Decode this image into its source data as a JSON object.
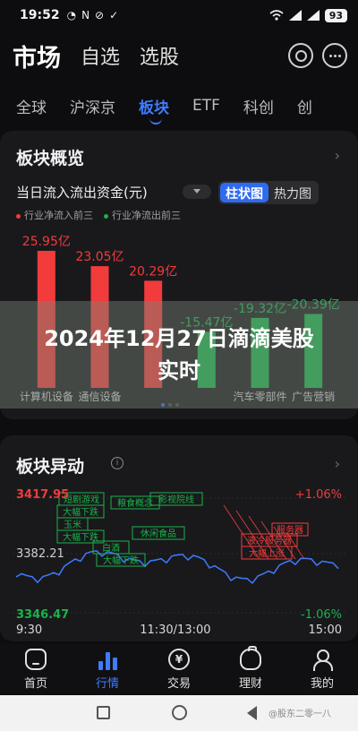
{
  "status_bar": {
    "time": "19:52",
    "icons": [
      "◔",
      "N",
      "⊘",
      "✓"
    ],
    "battery": "93"
  },
  "header": {
    "title": "市场",
    "tabs": [
      "自选",
      "选股"
    ]
  },
  "market_tabs": [
    "全球",
    "沪深京",
    "板块",
    "ETF",
    "科创",
    "创"
  ],
  "active_market_tab": 2,
  "overview": {
    "title": "板块概览",
    "subtitle": "当日流入流出资金(元)",
    "view_toggle": [
      "柱状图",
      "热力图"
    ],
    "legend": [
      "行业净流入前三",
      "行业净流出前三"
    ],
    "chevron": "›"
  },
  "chart_data": {
    "type": "bar",
    "categories": [
      "计算机设备",
      "通信设备",
      "",
      "",
      "汽车零部件",
      "广告营销"
    ],
    "values": [
      25.95,
      23.05,
      20.29,
      -15.47,
      -19.32,
      -20.39
    ],
    "labels": [
      "25.95亿",
      "23.05亿",
      "20.29亿",
      "-15.47亿",
      "-19.32亿",
      "-20.39亿"
    ],
    "ylabel": "亿",
    "colors": {
      "positive": "#f23b3b",
      "negative": "#19b34a"
    }
  },
  "banner": {
    "text": "2024年12月27日滴滴美股实时"
  },
  "movement": {
    "title": "板块异动",
    "info_icon": "i",
    "chevron": "›",
    "y_labels": [
      "3417.95",
      "3382.21",
      "3346.47"
    ],
    "pct_labels": [
      "+1.06%",
      "-1.06%"
    ],
    "time_labels": [
      "9:30",
      "11:30/13:00",
      "15:00"
    ],
    "annotations": [
      {
        "text": "短剧游戏",
        "color": "#19b34a"
      },
      {
        "text": "大幅下跌",
        "color": "#19b34a"
      },
      {
        "text": "粮食概念",
        "color": "#19b34a"
      },
      {
        "text": "影视院线",
        "color": "#19b34a"
      },
      {
        "text": "玉米",
        "color": "#19b34a"
      },
      {
        "text": "大幅下跌",
        "color": "#19b34a"
      },
      {
        "text": "休闲食品",
        "color": "#19b34a"
      },
      {
        "text": "白酒",
        "color": "#19b34a"
      },
      {
        "text": "大幅下跌",
        "color": "#19b34a"
      },
      {
        "text": "液冷服务器",
        "color": "#f23b3b"
      },
      {
        "text": "大幅上涨",
        "color": "#f23b3b"
      },
      {
        "text": "服务器",
        "color": "#f23b3b"
      }
    ]
  },
  "bottom_nav": [
    "首页",
    "行情",
    "交易",
    "理财",
    "我的"
  ],
  "bottom_nav_active": 1,
  "trade_glyph": "¥",
  "watermark": "@股东二零一八",
  "colors": {
    "accent": "#3d7cff",
    "up": "#f23b3b",
    "down": "#19b34a"
  }
}
